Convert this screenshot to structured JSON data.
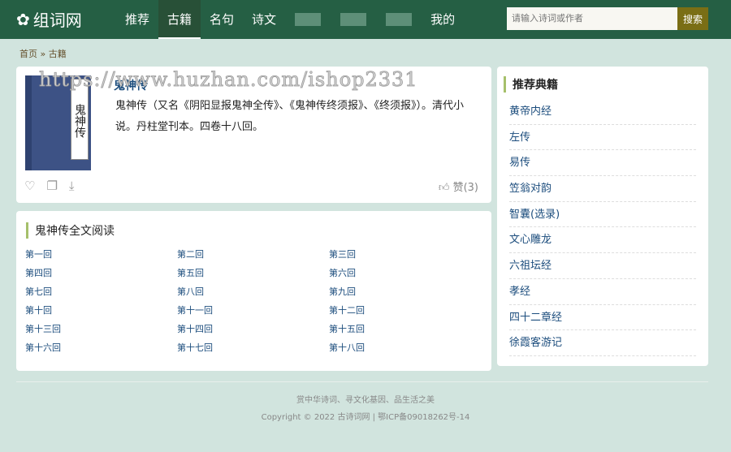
{
  "header": {
    "logo": "组词网",
    "nav": [
      "推荐",
      "古籍",
      "名句",
      "诗文",
      "我的"
    ],
    "search_placeholder": "请输入诗词或作者",
    "search_button": "搜索"
  },
  "breadcrumb": {
    "home": "首页",
    "sep": "»",
    "current": "古籍"
  },
  "book": {
    "cover_text": "鬼神传",
    "title": "鬼神传",
    "description": "鬼神传（又名《阴阳显报鬼神全传》、《鬼神传终须报》、《终须报》）。清代小说。丹柱堂刊本。四卷十八回。",
    "like": "赞(3)"
  },
  "chapters": {
    "heading": "鬼神传全文阅读",
    "items": [
      "第一回",
      "第二回",
      "第三回",
      "第四回",
      "第五回",
      "第六回",
      "第七回",
      "第八回",
      "第九回",
      "第十回",
      "第十一回",
      "第十二回",
      "第十三回",
      "第十四回",
      "第十五回",
      "第十六回",
      "第十七回",
      "第十八回"
    ]
  },
  "sidebar": {
    "heading": "推荐典籍",
    "items": [
      "黄帝内经",
      "左传",
      "易传",
      "笠翁对韵",
      "智囊(选录)",
      "文心雕龙",
      "六祖坛经",
      "孝经",
      "四十二章经",
      "徐霞客游记"
    ]
  },
  "footer": {
    "slogan": "赏中华诗词、寻文化基因、品生活之美",
    "copyright": "Copyright © 2022 古诗词网 | 鄂ICP备09018262号-14"
  },
  "watermark": "https://www.huzhan.com/ishop2331"
}
